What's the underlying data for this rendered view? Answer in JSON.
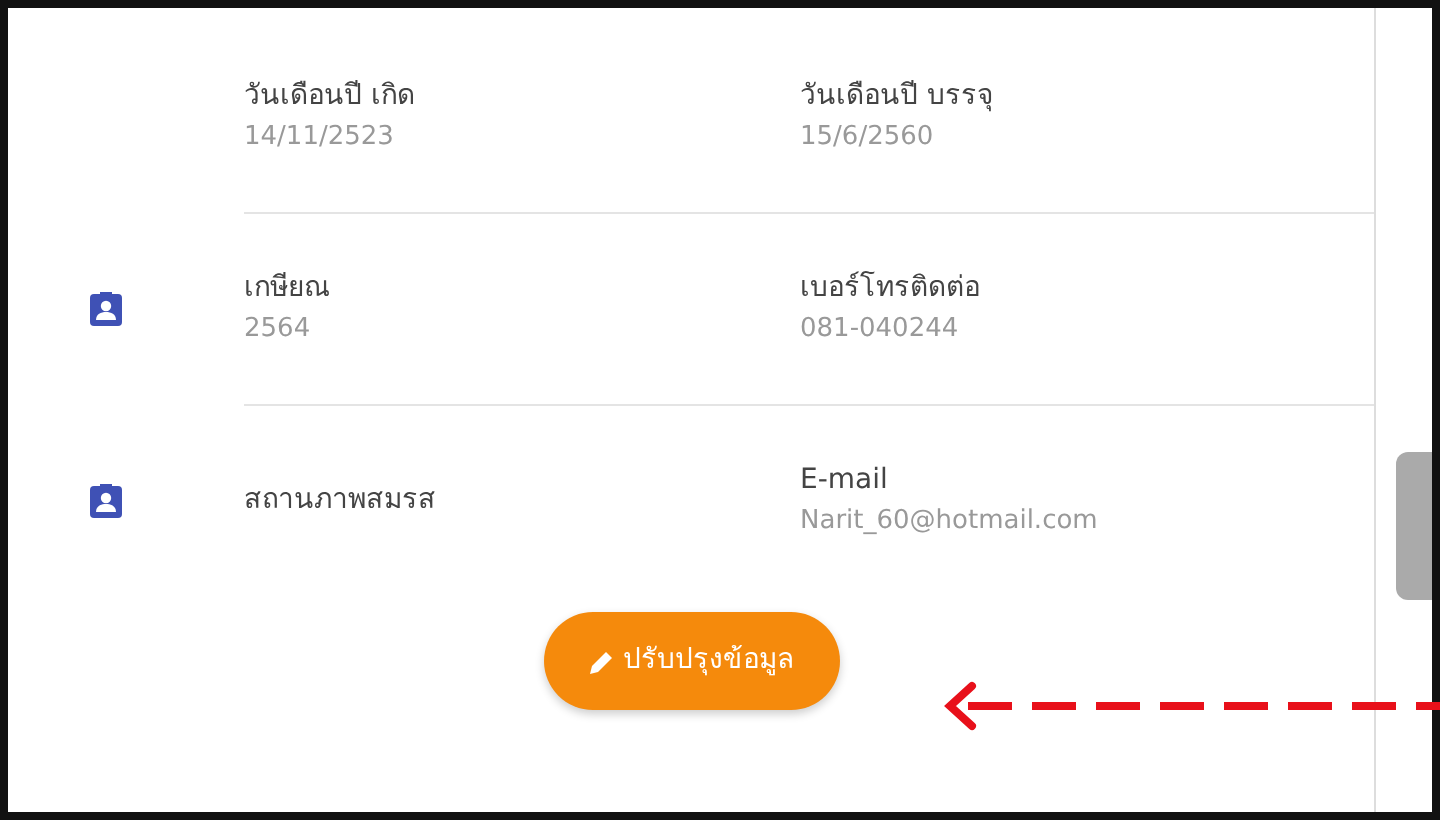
{
  "rows": [
    {
      "icon": false,
      "fields": [
        {
          "label": "วันเดือนปี เกิด",
          "value": "14/11/2523"
        },
        {
          "label": "วันเดือนปี บรรจุ",
          "value": "15/6/2560"
        }
      ]
    },
    {
      "icon": true,
      "fields": [
        {
          "label": "เกษียณ",
          "value": "2564"
        },
        {
          "label": "เบอร์โทรติดต่อ",
          "value": "081-040244"
        }
      ]
    },
    {
      "icon": true,
      "fields": [
        {
          "label": "สถานภาพสมรส"
        },
        {
          "label": "E-mail",
          "value": "Narit_60@hotmail.com"
        }
      ]
    }
  ],
  "button": {
    "label": "ปรับปรุงข้อมูล"
  }
}
